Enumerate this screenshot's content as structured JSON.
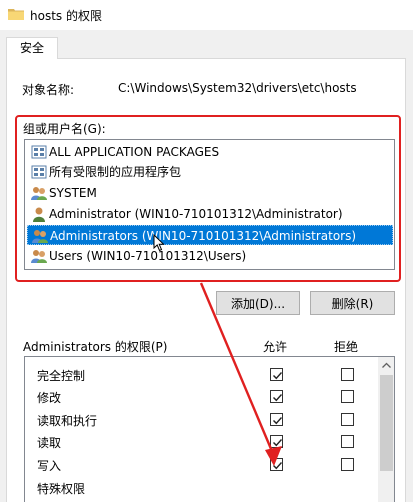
{
  "window": {
    "title": "hosts 的权限"
  },
  "tabs": [
    {
      "label": "安全",
      "active": true
    }
  ],
  "object": {
    "label": "对象名称:",
    "value": "C:\\Windows\\System32\\drivers\\etc\\hosts"
  },
  "groups": {
    "label": "组或用户名(G):",
    "items": [
      {
        "label": "ALL APPLICATION PACKAGES",
        "icon": "app-packages-icon",
        "selected": false
      },
      {
        "label": "所有受限制的应用程序包",
        "icon": "app-packages-icon",
        "selected": false
      },
      {
        "label": "SYSTEM",
        "icon": "users-group-icon",
        "selected": false
      },
      {
        "label": "Administrator (WIN10-710101312\\Administrator)",
        "icon": "user-icon",
        "selected": false
      },
      {
        "label": "Administrators (WIN10-710101312\\Administrators)",
        "icon": "users-group-icon",
        "selected": true
      },
      {
        "label": "Users (WIN10-710101312\\Users)",
        "icon": "users-group-icon",
        "selected": false
      }
    ]
  },
  "buttons": {
    "add": "添加(D)...",
    "remove": "删除(R)"
  },
  "permissions": {
    "title": "Administrators 的权限(P)",
    "allow_header": "允许",
    "deny_header": "拒绝",
    "rows": [
      {
        "name": "完全控制",
        "allow": true,
        "deny": false
      },
      {
        "name": "修改",
        "allow": true,
        "deny": false
      },
      {
        "name": "读取和执行",
        "allow": true,
        "deny": false
      },
      {
        "name": "读取",
        "allow": true,
        "deny": false
      },
      {
        "name": "写入",
        "allow": true,
        "deny": false
      },
      {
        "name": "特殊权限",
        "allow": false,
        "deny": false
      }
    ]
  },
  "colors": {
    "selection": "#0078d7",
    "annotation": "#e02020",
    "folder": "#f8d775"
  }
}
